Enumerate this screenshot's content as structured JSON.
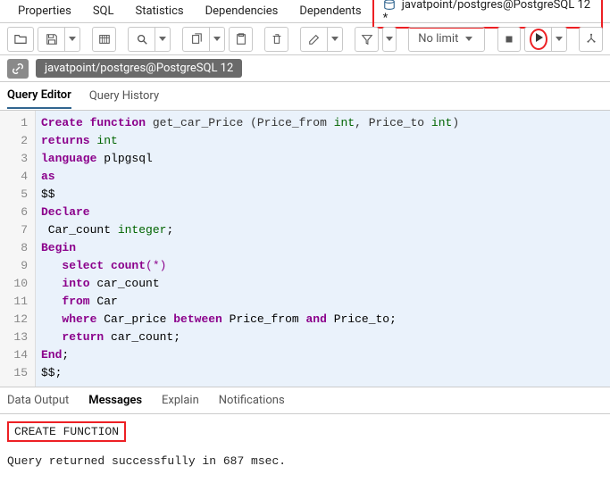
{
  "topTabs": {
    "properties": "Properties",
    "sql": "SQL",
    "statistics": "Statistics",
    "dependencies": "Dependencies",
    "dependents": "Dependents",
    "activeConn": "javatpoint/postgres@PostgreSQL 12 *"
  },
  "toolbar": {
    "nolimit": "No limit"
  },
  "breadcrumb": {
    "conn": "javatpoint/postgres@PostgreSQL 12"
  },
  "subTabs": {
    "queryEditor": "Query Editor",
    "queryHistory": "Query History"
  },
  "code": {
    "l1a": "Create",
    "l1b": "function",
    "l1c": " get_car_Price (Price_from ",
    "l1d": "int",
    "l1e": ", Price_to ",
    "l1f": "int",
    "l1g": ")",
    "l2a": "returns",
    "l2b": "int",
    "l3a": "language",
    "l3b": " plpgsql",
    "l4a": "as",
    "l5a": "$$",
    "l6a": "Declare",
    "l7a": " Car_count ",
    "l7b": "integer",
    "l7c": ";",
    "l8a": "Begin",
    "l9a": "select",
    "l9b": "count",
    "l9c": "(",
    "l9d": "*",
    "l9e": ")",
    "l10a": "into",
    "l10b": " car_count",
    "l11a": "from",
    "l11b": " Car",
    "l12a": "where",
    "l12b": " Car_price ",
    "l12c": "between",
    "l12d": " Price_from ",
    "l12e": "and",
    "l12f": " Price_to;",
    "l13a": "return",
    "l13b": " car_count;",
    "l14a": "End",
    "l14b": ";",
    "l15a": "$$;"
  },
  "lineNums": [
    "1",
    "2",
    "3",
    "4",
    "5",
    "6",
    "7",
    "8",
    "9",
    "10",
    "11",
    "12",
    "13",
    "14",
    "15"
  ],
  "outputTabs": {
    "dataOutput": "Data Output",
    "messages": "Messages",
    "explain": "Explain",
    "notifications": "Notifications"
  },
  "output": {
    "result": "CREATE FUNCTION",
    "status": "Query returned successfully in 687 msec."
  }
}
